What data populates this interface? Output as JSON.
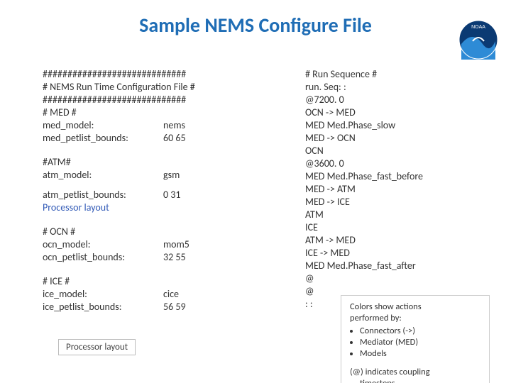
{
  "title": "Sample NEMS Configure File",
  "logo_text": "NOAA",
  "left": {
    "hashline": "#############################",
    "header": "# NEMS Run Time Configuration File #",
    "med_h": "# MED #",
    "med_model_k": "med_model:",
    "med_model_v": "nems",
    "med_pet_k": "med_petlist_bounds:",
    "med_pet_v": "60 65",
    "atm_h": "#ATM#",
    "atm_model_k": "atm_model:",
    "atm_model_v": "gsm",
    "atm_pet_k": "atm_petlist_bounds:",
    "atm_pet_v": "0 31",
    "proc_label": "Processor layout",
    "ocn_h": "# OCN #",
    "ocn_model_k": "ocn_model:",
    "ocn_model_v": "mom5",
    "ocn_pet_k": "ocn_petlist_bounds:",
    "ocn_pet_v": "32 55",
    "ice_h": "# ICE #",
    "ice_model_k": "ice_model:",
    "ice_model_v": "cice",
    "ice_pet_k": "ice_petlist_bounds:",
    "ice_pet_v": "56 59"
  },
  "right": {
    "l01": "# Run Sequence #",
    "l02": "run. Seq: :",
    "l03": "@7200. 0",
    "l04": "OCN -> MED",
    "l05": "MED Med.Phase_slow",
    "l06": "MED -> OCN",
    "l07": "OCN",
    "l08": "@3600. 0",
    "l09": "MED Med.Phase_fast_before",
    "l10": "MED -> ATM",
    "l11": "MED -> ICE",
    "l12": "ATM",
    "l13": "ICE",
    "l14": "ATM -> MED",
    "l15": "ICE -> MED",
    "l16": "MED Med.Phase_fast_after",
    "l17": "@",
    "l18": "@",
    "l19": ": :"
  },
  "legend": {
    "intro1": "Colors show actions",
    "intro2": "performed by:",
    "b1": "Connectors (->)",
    "b2": "Mediator (MED)",
    "b3": "Models",
    "note1": "(@) indicates coupling",
    "note2": "timesteps"
  }
}
